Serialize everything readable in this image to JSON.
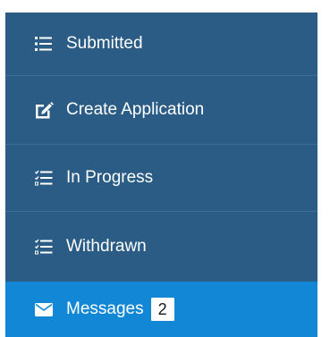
{
  "nav": {
    "items": [
      {
        "label": "Submitted",
        "icon": "list-icon"
      },
      {
        "label": "Create Application",
        "icon": "edit-icon"
      },
      {
        "label": "In Progress",
        "icon": "checklist-icon"
      },
      {
        "label": "Withdrawn",
        "icon": "checklist-icon"
      },
      {
        "label": "Messages",
        "icon": "envelope-icon",
        "badge": "2",
        "active": true
      }
    ]
  },
  "colors": {
    "sidebar": "#2a5c85",
    "active": "#1287d6",
    "text": "#ffffff"
  }
}
